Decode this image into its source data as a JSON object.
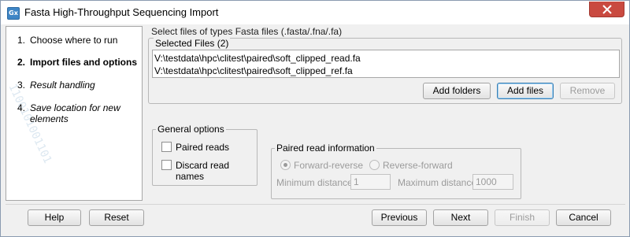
{
  "window": {
    "title": "Fasta High-Throughput Sequencing Import",
    "icon_text": "Gx"
  },
  "wizard_steps": [
    {
      "num": "1.",
      "label": "Choose where to run"
    },
    {
      "num": "2.",
      "label": "Import files and options"
    },
    {
      "num": "3.",
      "label": "Result handling"
    },
    {
      "num": "4.",
      "label": "Save location for new",
      "label2": "elements"
    }
  ],
  "watermark_text": "1100101001101",
  "files": {
    "instruction": "Select files of types Fasta files (.fasta/.fna/.fa)",
    "legend": "Selected Files (2)",
    "items": [
      "V:\\testdata\\hpc\\clitest\\paired\\soft_clipped_read.fa",
      "V:\\testdata\\hpc\\clitest\\paired\\soft_clipped_ref.fa"
    ],
    "add_folders_label": "Add folders",
    "add_files_label": "Add files",
    "remove_label": "Remove"
  },
  "general_options": {
    "legend": "General options",
    "paired_reads_label": "Paired reads",
    "discard_names_label": "Discard read names"
  },
  "paired_info": {
    "legend": "Paired read information",
    "forward_reverse_label": "Forward-reverse",
    "reverse_forward_label": "Reverse-forward",
    "min_distance_label": "Minimum distance",
    "min_distance_value": "1",
    "max_distance_label": "Maximum distance",
    "max_distance_value": "1000"
  },
  "footer": {
    "help_label": "Help",
    "reset_label": "Reset",
    "previous_label": "Previous",
    "next_label": "Next",
    "finish_label": "Finish",
    "cancel_label": "Cancel"
  }
}
